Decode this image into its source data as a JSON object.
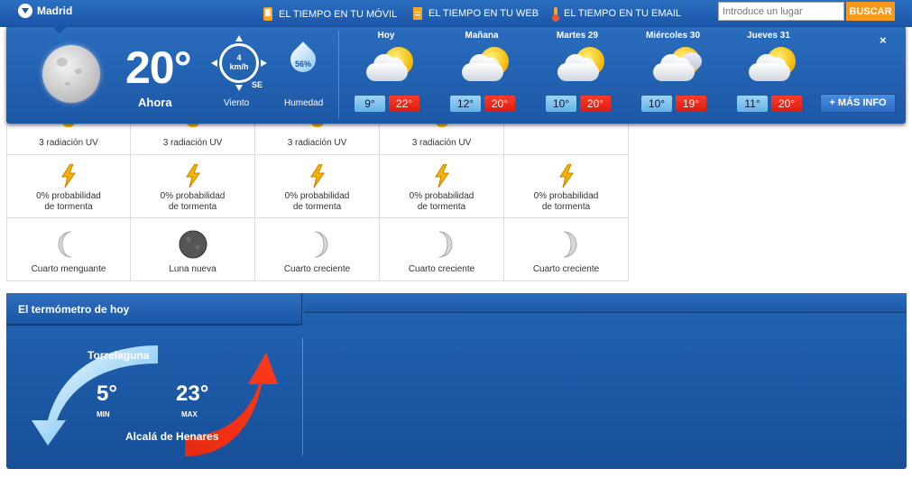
{
  "header": {
    "city": "Madrid",
    "links": [
      {
        "label": "EL TIEMPO EN TU MÓVIL",
        "icon": "phone-icon"
      },
      {
        "label": "EL TIEMPO EN TU WEB",
        "icon": "web-icon"
      },
      {
        "label": "EL TIEMPO EN TU EMAIL",
        "icon": "thermometer-icon"
      }
    ],
    "search_placeholder": "Introduce un lugar",
    "search_button": "BUSCAR"
  },
  "current": {
    "temperature": "20°",
    "label": "Ahora",
    "wind_speed": "4",
    "wind_unit": "km/h",
    "wind_direction": "SE",
    "wind_label": "Viento",
    "humidity": "56%",
    "humidity_label": "Humedad"
  },
  "forecast": [
    {
      "day": "Hoy",
      "min": "9°",
      "max": "22°"
    },
    {
      "day": "Mañana",
      "min": "12°",
      "max": "20°"
    },
    {
      "day": "Martes 29",
      "min": "10°",
      "max": "20°"
    },
    {
      "day": "Miércoles 30",
      "min": "10°",
      "max": "19°"
    },
    {
      "day": "Jueves 31",
      "min": "11°",
      "max": "20°"
    }
  ],
  "more_info": "+ MÁS INFO",
  "close": "×",
  "details": {
    "uv": [
      "3 radiación UV",
      "3 radiación UV",
      "3 radiación UV",
      "3 radiación UV",
      ""
    ],
    "storm": [
      [
        "0% probabilidad",
        "de tormenta"
      ],
      [
        "0% probabilidad",
        "de tormenta"
      ],
      [
        "0% probabilidad",
        "de tormenta"
      ],
      [
        "0% probabilidad",
        "de tormenta"
      ],
      [
        "0% probabilidad",
        "de tormenta"
      ]
    ],
    "moon": [
      "Cuarto menguante",
      "Luna nueva",
      "Cuarto creciente",
      "Cuarto creciente",
      "Cuarto creciente"
    ]
  },
  "thermometer": {
    "title": "El termómetro de hoy",
    "max_location": "Torrelaguna",
    "min_location": "Alcalá de Henares",
    "min_value": "5°",
    "min_label": "MIN",
    "max_value": "23°",
    "max_label": "MAX"
  },
  "colors": {
    "header_blue": "#1a55a8",
    "search_orange": "#f79a1b",
    "min_temp": "#62b3e6",
    "max_temp": "#d71d10"
  }
}
